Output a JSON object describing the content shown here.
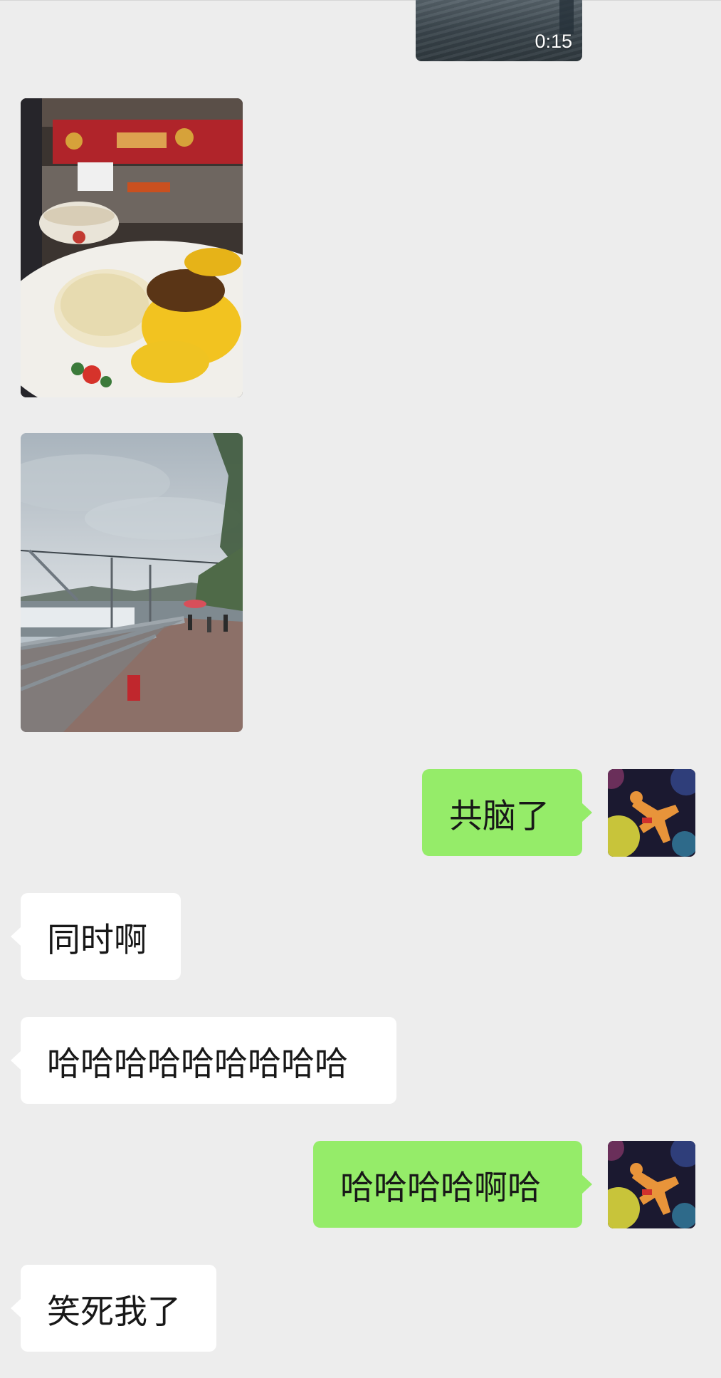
{
  "chat": {
    "video": {
      "duration": "0:15"
    },
    "messages": [
      {
        "text": "共脑了"
      },
      {
        "text": "同时啊"
      },
      {
        "text": "哈哈哈哈哈哈哈哈哈"
      },
      {
        "text": "哈哈哈哈啊哈"
      },
      {
        "text": "笑死我了"
      }
    ],
    "colors": {
      "background": "#ededed",
      "outgoing_bubble": "#95ec69",
      "incoming_bubble": "#ffffff",
      "text": "#181818"
    }
  }
}
